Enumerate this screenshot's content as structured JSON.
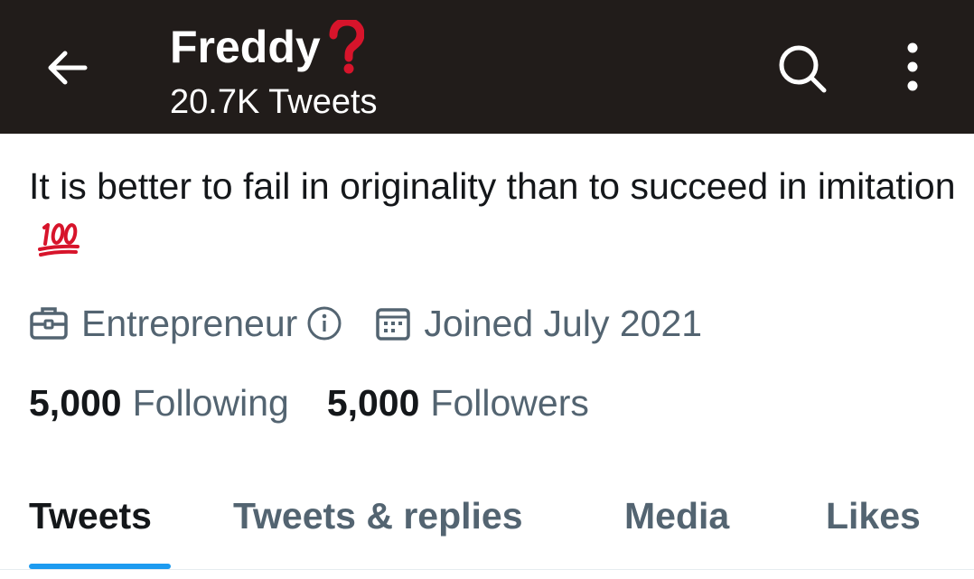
{
  "header": {
    "name": "Freddy",
    "name_emoji": "red-question-mark",
    "tweet_count": "20.7K Tweets",
    "background": "#211c1a"
  },
  "icons": {
    "back": "back-arrow-icon",
    "search": "search-icon",
    "more": "more-vertical-icon",
    "briefcase": "briefcase-icon",
    "info": "info-icon",
    "calendar": "calendar-icon",
    "hundred": "hundred-points-emoji"
  },
  "bio": {
    "text": "It is better to fail in originality than to succeed in imitation"
  },
  "meta": {
    "profession": "Entrepreneur",
    "joined": "Joined July 2021"
  },
  "stats": {
    "following_count": "5,000",
    "following_label": "Following",
    "followers_count": "5,000",
    "followers_label": "Followers"
  },
  "tabs": [
    {
      "label": "Tweets",
      "active": true
    },
    {
      "label": "Tweets & replies",
      "active": false
    },
    {
      "label": "Media",
      "active": false
    },
    {
      "label": "Likes",
      "active": false
    }
  ],
  "colors": {
    "accent": "#1d9bf0",
    "muted_text": "#536471",
    "primary_text": "#14171a",
    "emoji_red": "#d7142b"
  }
}
